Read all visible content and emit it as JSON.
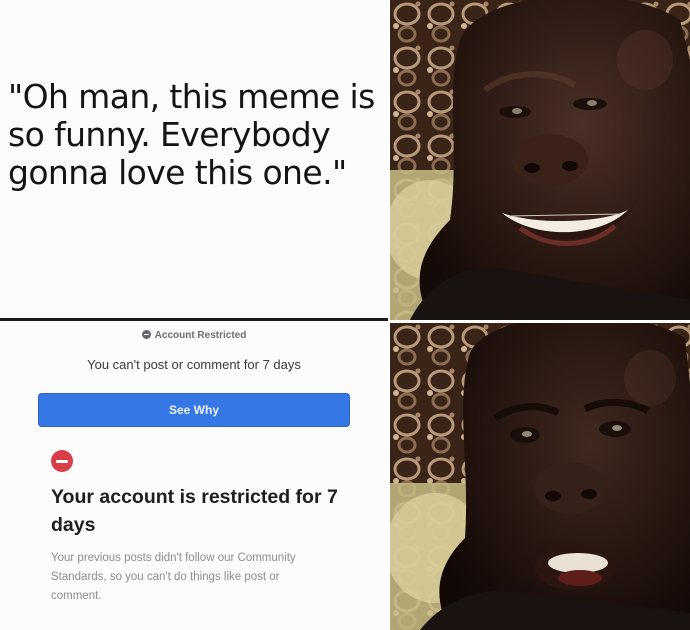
{
  "caption": {
    "text": "\"Oh man, this meme is so funny. Everybody gonna love this one.\""
  },
  "notice": {
    "header_label": "Account Restricted",
    "header_icon": "restricted-icon",
    "subtitle": "You can't post or comment for 7 days",
    "button_label": "See Why",
    "button_color": "#3578e5",
    "alert_icon": "stop-icon",
    "alert_color": "#d93d48",
    "title": "Your account is restricted for 7 days",
    "body": "Your previous posts didn't follow our Community Standards, so you can't do things like post or comment."
  }
}
